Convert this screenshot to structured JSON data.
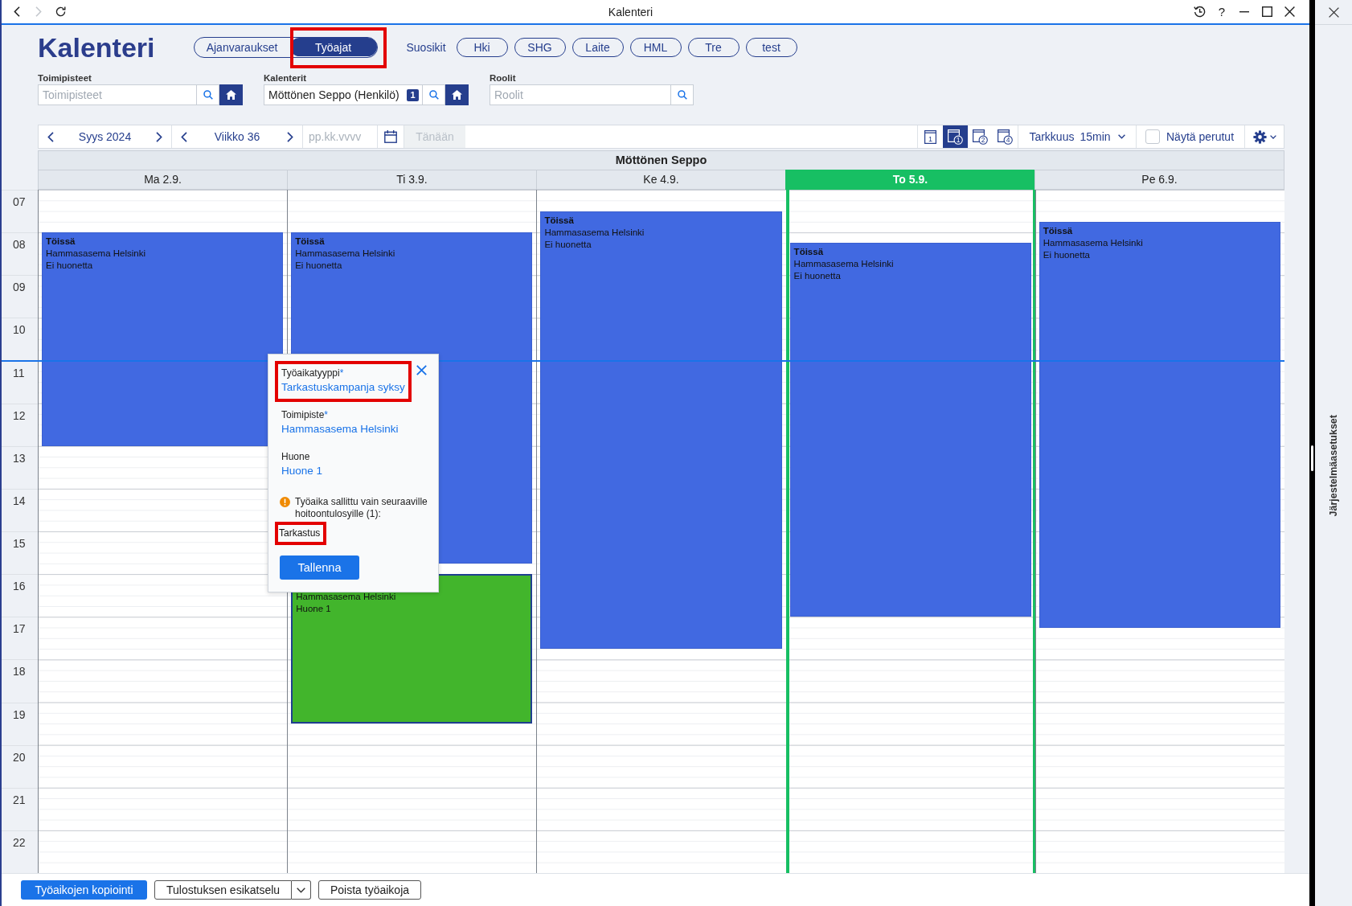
{
  "window": {
    "title": "Kalenteri",
    "help_label": "?",
    "back_disabled": false,
    "forward_disabled": true
  },
  "header": {
    "title": "Kalenteri",
    "modes": [
      {
        "label": "Ajanvaraukset",
        "selected": false,
        "highlighted": false
      },
      {
        "label": "Työajat",
        "selected": true,
        "highlighted": true
      }
    ],
    "favorites_label": "Suosikit",
    "favorites": [
      "Hki",
      "SHG",
      "Laite",
      "HML",
      "Tre",
      "test"
    ]
  },
  "filters": [
    {
      "label": "Toimipisteet",
      "placeholder": "Toimipisteet",
      "home_button": true
    },
    {
      "label": "Kalenterit",
      "value": "Möttönen Seppo (Henkilö)",
      "badge": "1",
      "home_button": true
    },
    {
      "label": "Roolit",
      "placeholder": "Roolit",
      "home_button": false
    }
  ],
  "toolbar": {
    "month": "Syys 2024",
    "week": "Viikko 36",
    "date_placeholder": "pp.kk.vvvv",
    "today_button": {
      "label": "Tänään",
      "disabled": true
    },
    "views": [
      {
        "kind": "day",
        "number": "1",
        "selected": false
      },
      {
        "kind": "range",
        "number": "1",
        "selected": true
      },
      {
        "kind": "range",
        "number": "2",
        "selected": false
      },
      {
        "kind": "range",
        "number": "4",
        "selected": false
      }
    ],
    "resolution": {
      "label": "Tarkkuus",
      "value": "15min"
    },
    "show_cancelled": {
      "label": "Näytä perutut",
      "checked": false
    }
  },
  "calendar": {
    "owner": "Möttönen Seppo",
    "hours": [
      "07",
      "08",
      "09",
      "10",
      "11",
      "12",
      "13",
      "14",
      "15",
      "16",
      "17",
      "18",
      "19",
      "20",
      "21",
      "22"
    ],
    "days": [
      {
        "label": "Ma 2.9.",
        "today": false,
        "events": [
          {
            "kind": "worktime",
            "selected": false,
            "title": "Töissä",
            "lines": [
              "Hammasasema Helsinki",
              "Ei huonetta"
            ]
          }
        ]
      },
      {
        "label": "Ti 3.9.",
        "today": false,
        "events": [
          {
            "kind": "worktime",
            "selected": false,
            "title": "Töissä",
            "lines": [
              "Hammasasema Helsinki",
              "Ei huonetta"
            ]
          },
          {
            "kind": "booking",
            "selected": true,
            "lines": [
              "Hammasasema Helsinki",
              "Huone 1"
            ]
          }
        ]
      },
      {
        "label": "Ke 4.9.",
        "today": false,
        "events": [
          {
            "kind": "worktime",
            "selected": false,
            "title": "Töissä",
            "lines": [
              "Hammasasema Helsinki",
              "Ei huonetta"
            ]
          }
        ]
      },
      {
        "label": "To 5.9.",
        "today": true,
        "events": [
          {
            "kind": "worktime",
            "selected": false,
            "title": "Töissä",
            "lines": [
              "Hammasasema Helsinki",
              "Ei huonetta"
            ]
          }
        ]
      },
      {
        "label": "Pe 6.9.",
        "today": false,
        "events": [
          {
            "kind": "worktime",
            "selected": false,
            "title": "Töissä",
            "lines": [
              "Hammasasema Helsinki",
              "Ei huonetta"
            ]
          }
        ]
      }
    ]
  },
  "popup": {
    "fields": [
      {
        "label": "Työaikatyyppi",
        "required_mark": "*",
        "value": "Tarkastuskampanja syksy",
        "highlighted": true
      },
      {
        "label": "Toimipiste",
        "required_mark": "*",
        "value": "Hammasasema Helsinki",
        "highlighted": false
      },
      {
        "label": "Huone",
        "value": "Huone 1",
        "highlighted": false
      }
    ],
    "warning": "Työaika sallittu vain seuraaville hoitoontulosyille (1):",
    "allowed": [
      {
        "label": "Tarkastus",
        "highlighted": true
      }
    ],
    "save_button": "Tallenna"
  },
  "footer": {
    "buttons": [
      {
        "kind": "primary",
        "label": "Työaikojen kopiointi"
      },
      {
        "kind": "split",
        "label": "Tulostuksen esikatselu"
      },
      {
        "kind": "outline",
        "label": "Poista työaikoja"
      }
    ]
  },
  "side_panel": {
    "title": "Järjestelmäasetukset"
  }
}
